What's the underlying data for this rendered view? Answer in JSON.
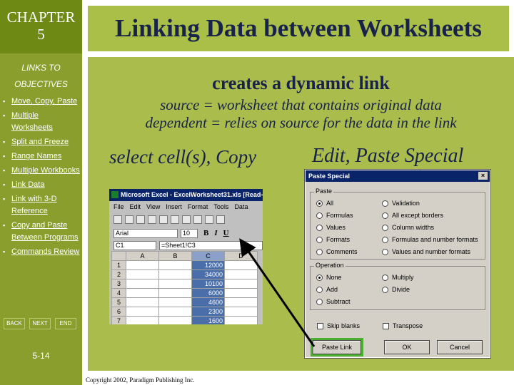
{
  "sidebar": {
    "chapter_line1": "CHAPTER",
    "chapter_line2": "5",
    "links_to": "LINKS TO",
    "objectives": "OBJECTIVES",
    "items": [
      {
        "label": "Move, Copy, Paste"
      },
      {
        "label": "Multiple Worksheets"
      },
      {
        "label": "Split and Freeze"
      },
      {
        "label": "Range Names"
      },
      {
        "label": "Multiple Workbooks"
      },
      {
        "label": "Link Data"
      },
      {
        "label": "Link with 3-D Reference"
      },
      {
        "label": "Copy and Paste Between Programs"
      },
      {
        "label": "Commands Review"
      }
    ],
    "nav": {
      "back": "BACK",
      "next": "NEXT",
      "end": "END"
    },
    "page_number": "5-14"
  },
  "slide": {
    "title": "Linking Data between Worksheets",
    "heading": "creates a dynamic link",
    "line1": "source = worksheet that contains original data",
    "line2": "dependent = relies on source for the data in the link",
    "select_copy": "select cell(s), Copy",
    "edit_paste": "Edit, Paste Special"
  },
  "excel": {
    "title": "Microsoft Excel - ExcelWorksheet31.xls [Read-",
    "menu": [
      "File",
      "Edit",
      "View",
      "Insert",
      "Format",
      "Tools",
      "Data"
    ],
    "font": "Arial",
    "font_size": "10",
    "name_box": "C1",
    "formula": "=Sheet1!C3",
    "columns": [
      "A",
      "B",
      "C",
      "D"
    ],
    "rows": [
      {
        "n": "1",
        "c": "12000"
      },
      {
        "n": "2",
        "c": "34000"
      },
      {
        "n": "3",
        "c": "10100"
      },
      {
        "n": "4",
        "c": "6000"
      },
      {
        "n": "5",
        "c": "4600"
      },
      {
        "n": "6",
        "c": "2300"
      },
      {
        "n": "7",
        "c": "1600"
      }
    ]
  },
  "dialog": {
    "title": "Paste Special",
    "close": "×",
    "paste_label": "Paste",
    "paste_options": [
      {
        "label": "All",
        "selected": true
      },
      {
        "label": "Formulas",
        "selected": false
      },
      {
        "label": "Values",
        "selected": false
      },
      {
        "label": "Formats",
        "selected": false
      },
      {
        "label": "Comments",
        "selected": false
      },
      {
        "label": "Validation",
        "selected": false
      },
      {
        "label": "All except borders",
        "selected": false
      },
      {
        "label": "Column widths",
        "selected": false
      },
      {
        "label": "Formulas and number formats",
        "selected": false
      },
      {
        "label": "Values and number formats",
        "selected": false
      }
    ],
    "operation_label": "Operation",
    "operation_options": [
      {
        "label": "None",
        "selected": true
      },
      {
        "label": "Add",
        "selected": false
      },
      {
        "label": "Subtract",
        "selected": false
      },
      {
        "label": "Multiply",
        "selected": false
      },
      {
        "label": "Divide",
        "selected": false
      }
    ],
    "skip_blanks": "Skip blanks",
    "transpose": "Transpose",
    "paste_link": "Paste Link",
    "ok": "OK",
    "cancel": "Cancel"
  },
  "footer": "Copyright 2002, Paradigm Publishing Inc."
}
